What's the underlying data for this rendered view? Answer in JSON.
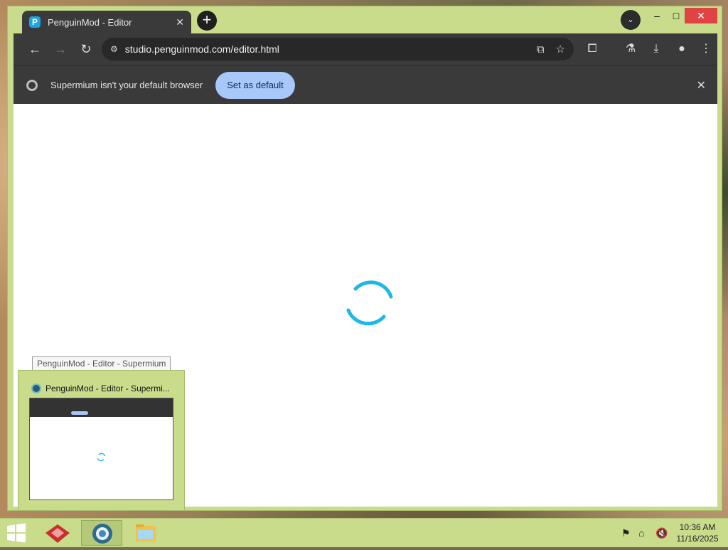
{
  "browser": {
    "tab": {
      "title": "PenguinMod - Editor",
      "favicon_letter": "P"
    },
    "address_bar": {
      "url": "studio.penguinmod.com/editor.html"
    },
    "infobar": {
      "message": "Supermium isn't your default browser",
      "button_label": "Set as default"
    }
  },
  "taskbar_preview": {
    "tooltip": "PenguinMod - Editor - Supermium",
    "title": "PenguinMod - Editor - Supermi..."
  },
  "clock": {
    "time": "10:36 AM",
    "date": "11/16/2025"
  },
  "colors": {
    "accent_window": "#c9dc8c",
    "spinner": "#1fb6e8",
    "infobar_button": "#a8c7fa"
  },
  "icons": [
    "back-icon",
    "forward-icon",
    "reload-icon",
    "site-info-icon",
    "install-app-icon",
    "bookmark-star-icon",
    "extensions-icon",
    "labs-icon",
    "download-icon",
    "profile-icon",
    "menu-icon"
  ]
}
